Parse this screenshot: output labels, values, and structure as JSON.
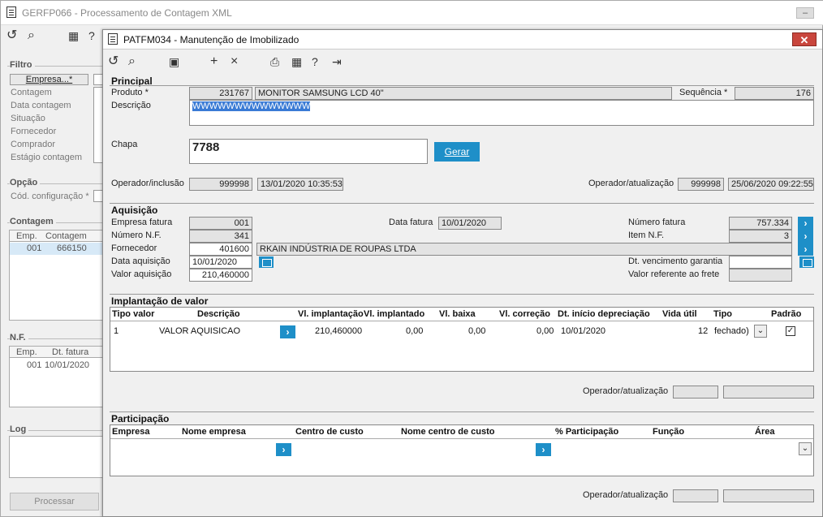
{
  "outer": {
    "title": "GERFP066 - Processamento de Contagem XML",
    "filtro": {
      "label": "Filtro",
      "empresa_btn": "Empresa...*",
      "items": [
        "Contagem",
        "Data contagem",
        "Situação",
        "Fornecedor",
        "Comprador",
        "Estágio contagem"
      ]
    },
    "opcao": {
      "label": "Opção",
      "cod_config": "Cód. configuração *"
    },
    "contagem": {
      "label": "Contagem",
      "col_emp": "Emp.",
      "col_contagem": "Contagem",
      "row_emp": "001",
      "row_contagem": "666150"
    },
    "nf": {
      "label": "N.F.",
      "col_emp": "Emp.",
      "col_dt": "Dt. fatura",
      "row_emp": "001",
      "row_dt": "10/01/2020"
    },
    "log": {
      "label": "Log"
    },
    "processar": "Processar"
  },
  "inner": {
    "title": "PATFM034 - Manutenção de Imobilizado",
    "close": "✕",
    "principal": {
      "title": "Principal",
      "produto_label": "Produto *",
      "produto_code": "231767",
      "produto_name": "MONITOR SAMSUNG LCD 40\"",
      "sequencia_label": "Sequência *",
      "sequencia": "176",
      "descricao_label": "Descrição",
      "descricao": "WWWWWWWWWWWWWW",
      "chapa_label": "Chapa",
      "chapa": "7788",
      "gerar": "Gerar",
      "op_inclusao_label": "Operador/inclusão",
      "op_inclusao": "999998",
      "op_inclusao_dt": "13/01/2020 10:35:53",
      "op_atualizacao_label": "Operador/atualização",
      "op_atualizacao": "999998",
      "op_atualizacao_dt": "25/06/2020 09:22:55"
    },
    "aquisicao": {
      "title": "Aquisição",
      "empresa_fatura_label": "Empresa fatura",
      "empresa_fatura": "001",
      "data_fatura_label": "Data fatura",
      "data_fatura": "10/01/2020",
      "numero_fatura_label": "Número fatura",
      "numero_fatura": "757.334",
      "numero_nf_label": "Número N.F.",
      "numero_nf": "341",
      "item_nf_label": "Item N.F.",
      "item_nf": "3",
      "fornecedor_label": "Fornecedor",
      "fornecedor_code": "401600",
      "fornecedor_name": "RKAIN INDÚSTRIA DE ROUPAS LTDA",
      "data_aquisicao_label": "Data aquisição",
      "data_aquisicao": "10/01/2020",
      "dt_venc_label": "Dt. vencimento garantia",
      "valor_aquisicao_label": "Valor aquisição",
      "valor_aquisicao": "210,460000",
      "valor_frete_label": "Valor referente ao frete"
    },
    "implantacao": {
      "title": "Implantação de valor",
      "headers": [
        "Tipo valor",
        "Descrição",
        "Vl. implantação",
        "Vl. implantado",
        "Vl. baixa",
        "Vl. correção",
        "Dt. início depreciação",
        "Vida útil",
        "Tipo",
        "Padrão"
      ],
      "row": [
        "1",
        "VALOR AQUISICAO",
        "210,460000",
        "0,00",
        "0,00",
        "0,00",
        "10/01/2020",
        "12",
        "fechado)"
      ],
      "op_label": "Operador/atualização"
    },
    "participacao": {
      "title": "Participação",
      "headers": [
        "Empresa",
        "Nome empresa",
        "Centro de custo",
        "Nome centro de custo",
        "% Participação",
        "Função",
        "Área"
      ],
      "op_label": "Operador/atualização"
    }
  }
}
